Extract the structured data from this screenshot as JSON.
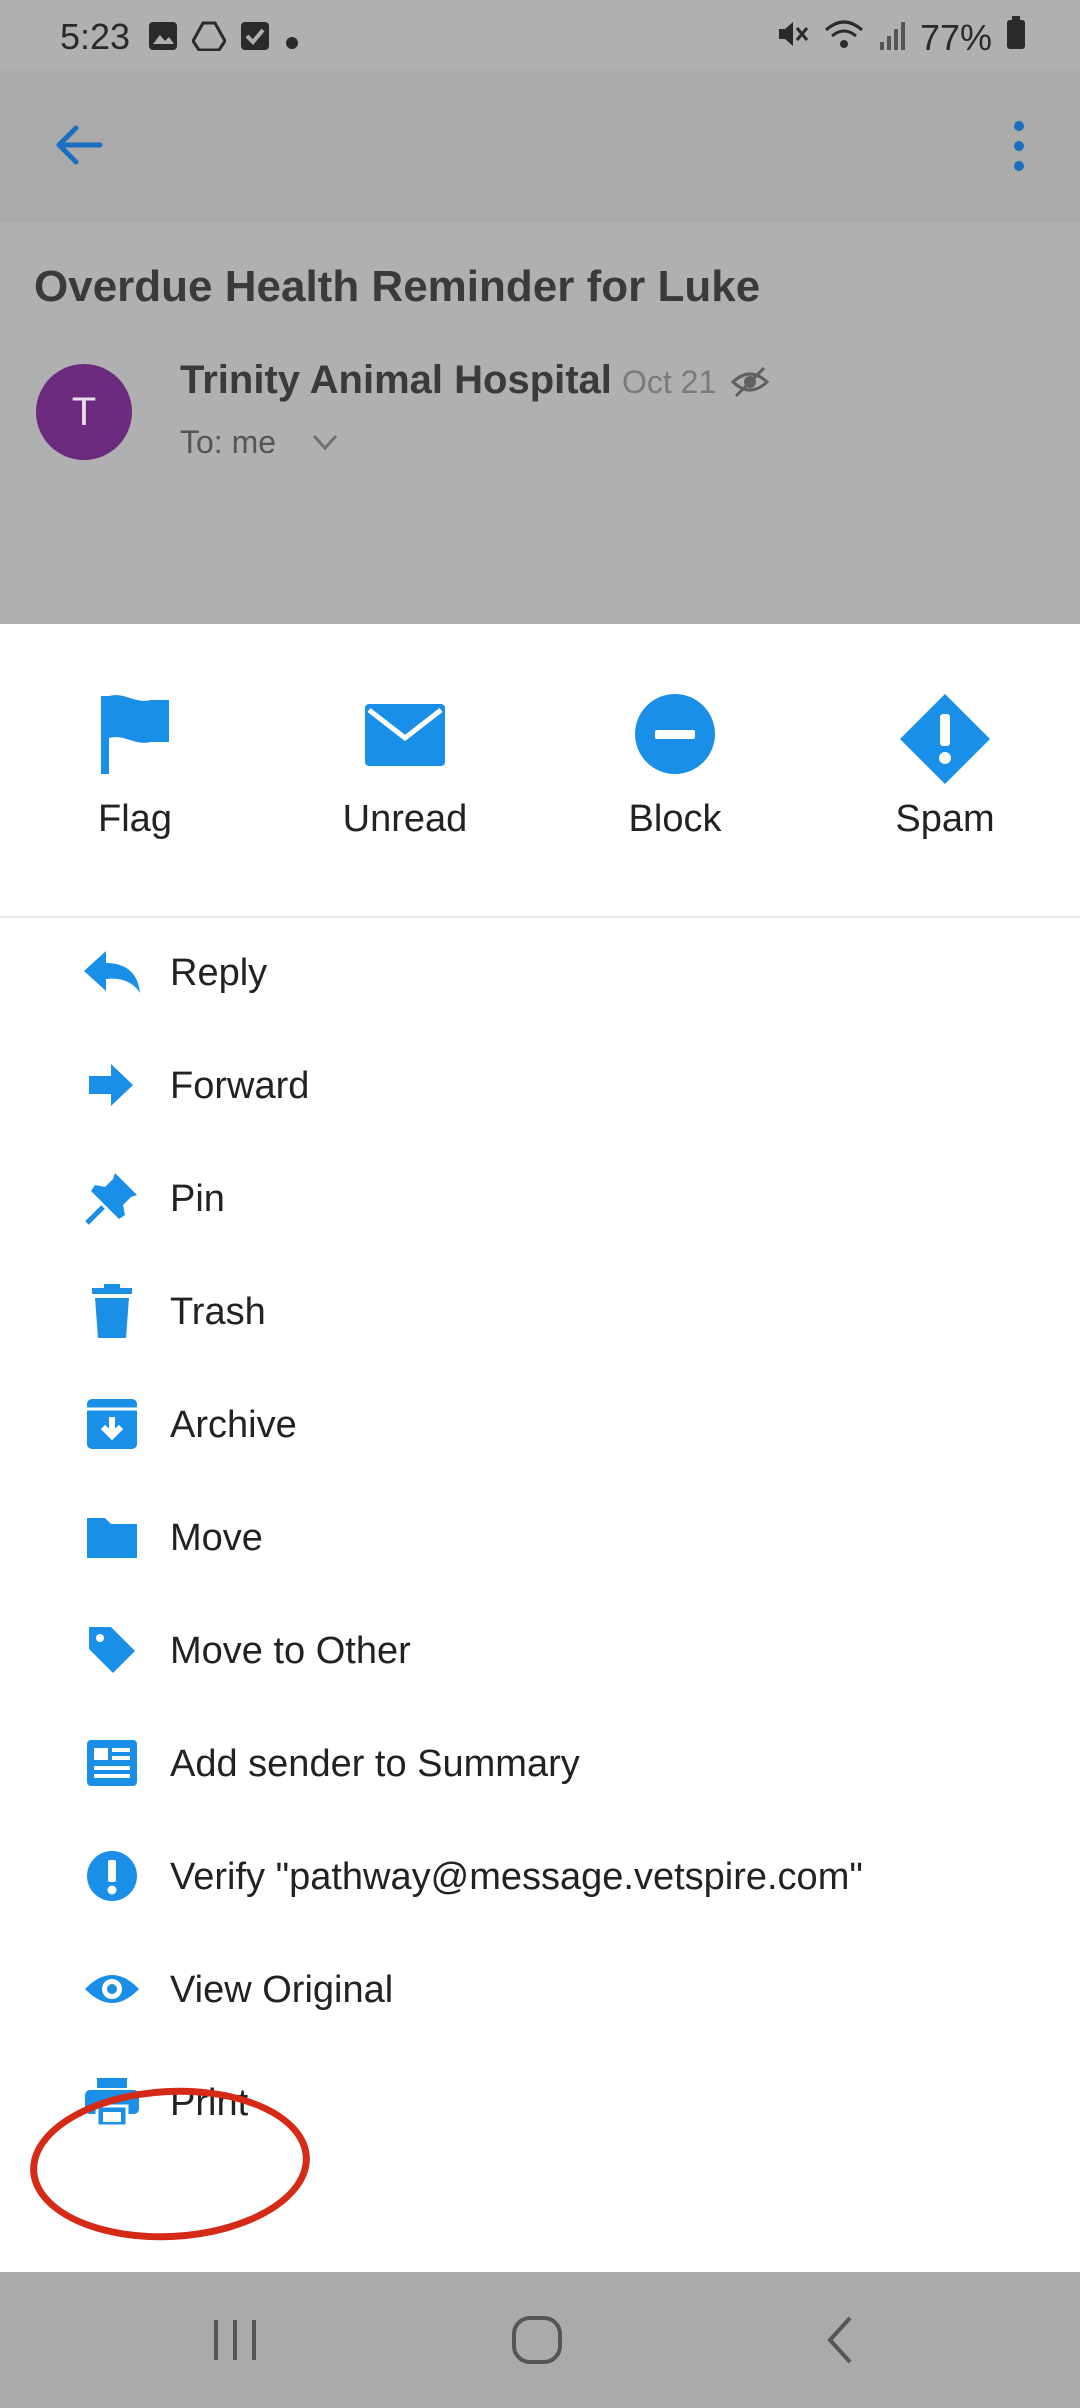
{
  "status": {
    "time": "5:23",
    "battery": "77%"
  },
  "email": {
    "subject": "Overdue Health Reminder for Luke",
    "avatar_letter": "T",
    "sender": "Trinity Animal Hospital",
    "date": "Oct 21",
    "to": "To: me"
  },
  "quick_actions": [
    {
      "label": "Flag",
      "icon": "flag-icon"
    },
    {
      "label": "Unread",
      "icon": "envelope-icon"
    },
    {
      "label": "Block",
      "icon": "block-icon"
    },
    {
      "label": "Spam",
      "icon": "spam-icon"
    }
  ],
  "menu": [
    {
      "label": "Reply",
      "icon": "reply-icon"
    },
    {
      "label": "Forward",
      "icon": "forward-icon"
    },
    {
      "label": "Pin",
      "icon": "pin-icon"
    },
    {
      "label": "Trash",
      "icon": "trash-icon"
    },
    {
      "label": "Archive",
      "icon": "archive-icon"
    },
    {
      "label": "Move",
      "icon": "folder-icon"
    },
    {
      "label": "Move to Other",
      "icon": "tag-icon"
    },
    {
      "label": "Add sender to Summary",
      "icon": "newspaper-icon"
    },
    {
      "label": "Verify \"pathway@message.vetspire.com\"",
      "icon": "alert-icon"
    },
    {
      "label": "View Original",
      "icon": "eye-icon"
    },
    {
      "label": "Print",
      "icon": "print-icon"
    }
  ],
  "colors": {
    "accent": "#1a8fe8",
    "avatar": "#6b2a7e",
    "highlight": "#d42a16"
  }
}
